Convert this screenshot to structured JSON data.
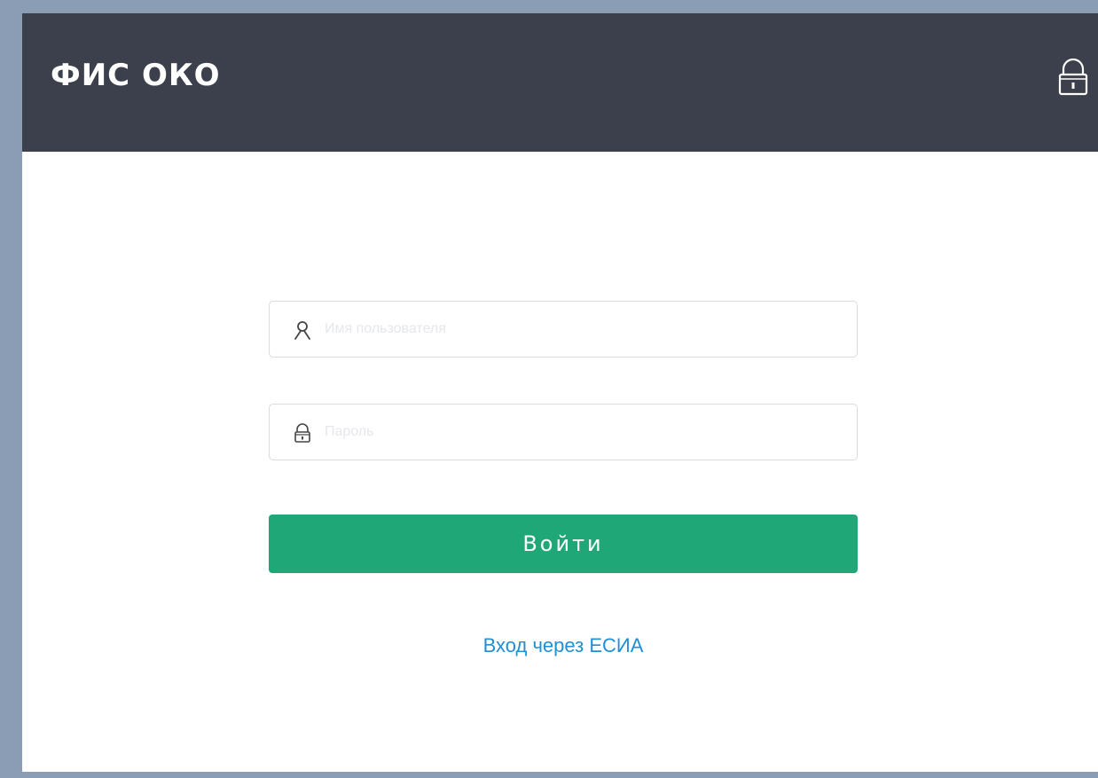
{
  "app": {
    "title": "ФИС ОКО"
  },
  "header": {
    "lock_icon": "lock-icon"
  },
  "login_form": {
    "username": {
      "icon": "user-icon",
      "value": "",
      "placeholder": "Имя пользователя"
    },
    "password": {
      "icon": "lock-icon",
      "value": "",
      "placeholder": "Пароль"
    },
    "submit_label": "Войти",
    "esia_link_label": "Вход через ЕСИА"
  },
  "colors": {
    "header_bg": "#3c404c",
    "primary_button": "#20a778",
    "link": "#1f8fd6",
    "desktop_bg": "#8a9db5"
  }
}
